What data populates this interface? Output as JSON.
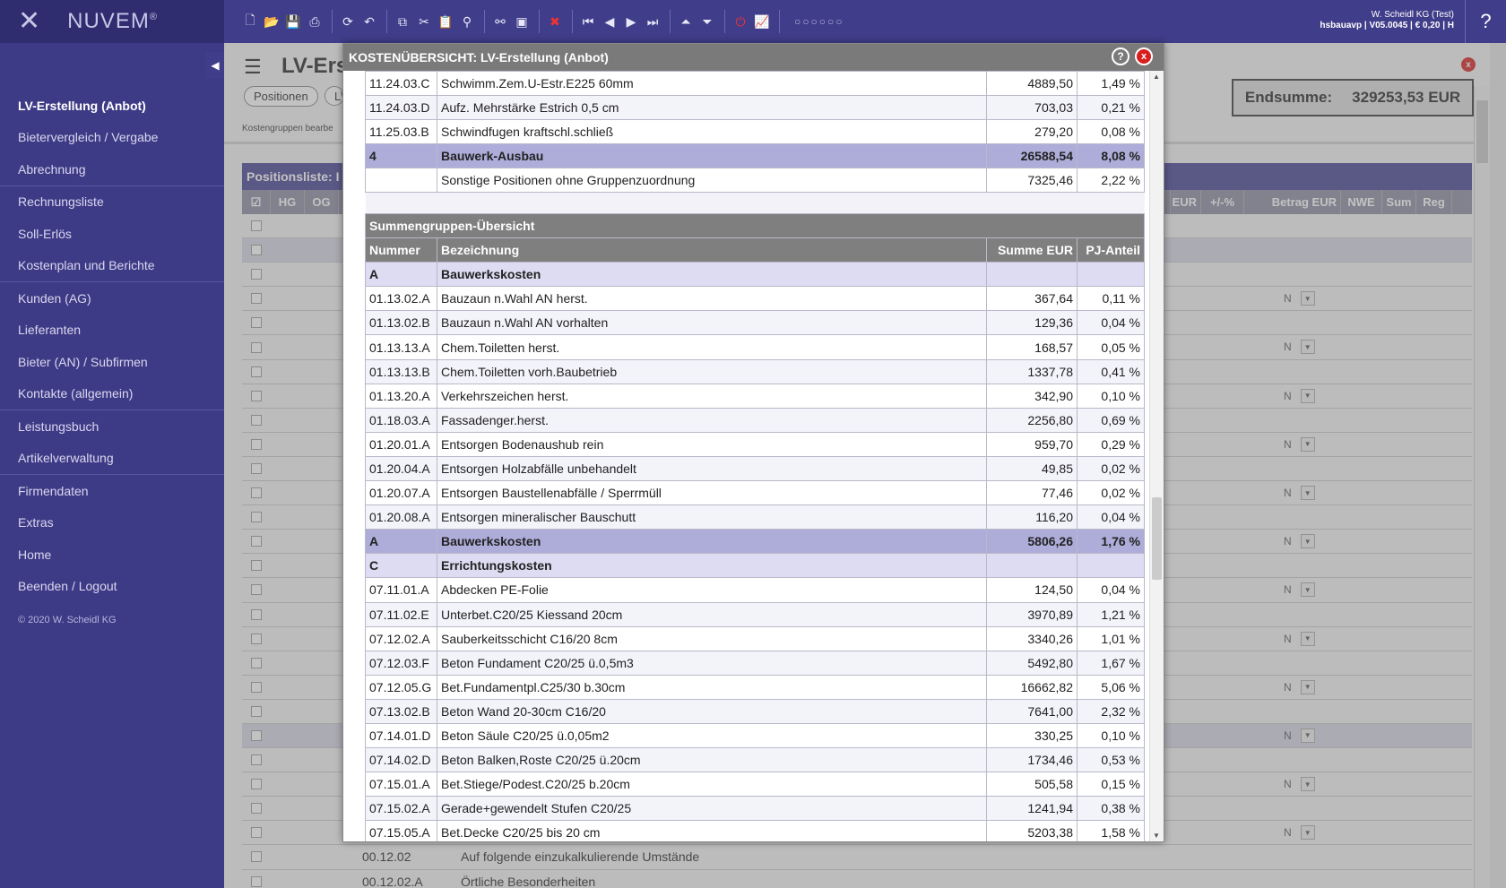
{
  "brand": {
    "name": "NUVEM",
    "mark": "®"
  },
  "sidebar": {
    "items": [
      {
        "label": "LV-Erstellung (Anbot)"
      },
      {
        "label": "Bietervergleich / Vergabe"
      },
      {
        "label": "Abrechnung"
      },
      {
        "label": "Rechnungsliste"
      },
      {
        "label": "Soll-Erlös"
      },
      {
        "label": "Kostenplan und Berichte"
      },
      {
        "label": "Kunden (AG)"
      },
      {
        "label": "Lieferanten"
      },
      {
        "label": "Bieter (AN) / Subfirmen"
      },
      {
        "label": "Kontakte (allgemein)"
      },
      {
        "label": "Leistungsbuch"
      },
      {
        "label": "Artikelverwaltung"
      },
      {
        "label": "Firmendaten"
      },
      {
        "label": "Extras"
      },
      {
        "label": "Home"
      },
      {
        "label": "Beenden / Logout"
      }
    ],
    "copyright": "© 2020 W. Scheidl KG"
  },
  "toolbar": {
    "dots": "○○○○○○",
    "help": "?",
    "user_line1": "W. Scheidl KG (Test)",
    "user_line2": "hsbauavp | V05.0045 | € 0,20 | H"
  },
  "background": {
    "title": "LV-Ers",
    "tab1": "Positionen",
    "tab2": "L\\",
    "subtitle": "Kostengruppen bearbe",
    "poslist": "Positionsliste: I",
    "endsum_label": "Endsumme:",
    "endsum_value": "329253,53 EUR",
    "columns": {
      "hg": "HG",
      "og": "OG",
      "eur": "EUR",
      "pm": "+/-%",
      "betrag": "Betrag EUR",
      "nwe": "NWE",
      "sum": "Sum",
      "reg": "Reg"
    },
    "nwe_value": "N",
    "bottom_rows": [
      {
        "nr": "00.12.02",
        "text": "Auf folgende einzukalkulierende Umstände"
      },
      {
        "nr": "00.12.02.A",
        "text": "Örtliche Besonderheiten"
      }
    ]
  },
  "modal": {
    "title": "KOSTENÜBERSICHT: LV-Erstellung (Anbot)",
    "help": "?",
    "close": "x",
    "top_rows": [
      {
        "kind": "odd",
        "nr": "11.24.03.C",
        "desc": "Schwimm.Zem.U-Estr.E225 60mm",
        "sum": "4889,50",
        "pct": "1,49 %"
      },
      {
        "kind": "even",
        "nr": "11.24.03.D",
        "desc": "Aufz. Mehrstärke Estrich 0,5 cm",
        "sum": "703,03",
        "pct": "0,21 %"
      },
      {
        "kind": "odd",
        "nr": "11.25.03.B",
        "desc": "Schwindfugen kraftschl.schließ",
        "sum": "279,20",
        "pct": "0,08 %"
      },
      {
        "kind": "group",
        "nr": "4",
        "desc": "Bauwerk-Ausbau",
        "sum": "26588,54",
        "pct": "8,08 %"
      },
      {
        "kind": "odd",
        "nr": "",
        "desc": "Sonstige Positionen ohne Gruppenzuordnung",
        "sum": "7325,46",
        "pct": "2,22 %"
      }
    ],
    "section_title": "Summengruppen-Übersicht",
    "columns": {
      "nr": "Nummer",
      "desc": "Bezeichnung",
      "sum": "Summe EUR",
      "pct": "PJ-Anteil"
    },
    "rows": [
      {
        "kind": "head",
        "nr": "A",
        "desc": "Bauwerkskosten",
        "sum": "",
        "pct": ""
      },
      {
        "kind": "odd",
        "nr": "01.13.02.A",
        "desc": "Bauzaun n.Wahl AN herst.",
        "sum": "367,64",
        "pct": "0,11 %"
      },
      {
        "kind": "even",
        "nr": "01.13.02.B",
        "desc": "Bauzaun n.Wahl AN vorhalten",
        "sum": "129,36",
        "pct": "0,04 %"
      },
      {
        "kind": "odd",
        "nr": "01.13.13.A",
        "desc": "Chem.Toiletten herst.",
        "sum": "168,57",
        "pct": "0,05 %"
      },
      {
        "kind": "even",
        "nr": "01.13.13.B",
        "desc": "Chem.Toiletten vorh.Baubetrieb",
        "sum": "1337,78",
        "pct": "0,41 %"
      },
      {
        "kind": "odd",
        "nr": "01.13.20.A",
        "desc": "Verkehrszeichen herst.",
        "sum": "342,90",
        "pct": "0,10 %"
      },
      {
        "kind": "even",
        "nr": "01.18.03.A",
        "desc": "Fassadenger.herst.",
        "sum": "2256,80",
        "pct": "0,69 %"
      },
      {
        "kind": "odd",
        "nr": "01.20.01.A",
        "desc": "Entsorgen Bodenaushub rein",
        "sum": "959,70",
        "pct": "0,29 %"
      },
      {
        "kind": "even",
        "nr": "01.20.04.A",
        "desc": "Entsorgen Holzabfälle unbehandelt",
        "sum": "49,85",
        "pct": "0,02 %"
      },
      {
        "kind": "odd",
        "nr": "01.20.07.A",
        "desc": "Entsorgen Baustellenabfälle / Sperrmüll",
        "sum": "77,46",
        "pct": "0,02 %"
      },
      {
        "kind": "even",
        "nr": "01.20.08.A",
        "desc": "Entsorgen mineralischer Bauschutt",
        "sum": "116,20",
        "pct": "0,04 %"
      },
      {
        "kind": "group",
        "nr": "A",
        "desc": "Bauwerkskosten",
        "sum": "5806,26",
        "pct": "1,76 %"
      },
      {
        "kind": "head",
        "nr": "C",
        "desc": "Errichtungskosten",
        "sum": "",
        "pct": ""
      },
      {
        "kind": "odd",
        "nr": "07.11.01.A",
        "desc": "Abdecken PE-Folie",
        "sum": "124,50",
        "pct": "0,04 %"
      },
      {
        "kind": "even",
        "nr": "07.11.02.E",
        "desc": "Unterbet.C20/25 Kiessand 20cm",
        "sum": "3970,89",
        "pct": "1,21 %"
      },
      {
        "kind": "odd",
        "nr": "07.12.02.A",
        "desc": "Sauberkeitsschicht C16/20 8cm",
        "sum": "3340,26",
        "pct": "1,01 %"
      },
      {
        "kind": "even",
        "nr": "07.12.03.F",
        "desc": "Beton Fundament C20/25 ü.0,5m3",
        "sum": "5492,80",
        "pct": "1,67 %"
      },
      {
        "kind": "odd",
        "nr": "07.12.05.G",
        "desc": "Bet.Fundamentpl.C25/30 b.30cm",
        "sum": "16662,82",
        "pct": "5,06 %"
      },
      {
        "kind": "even",
        "nr": "07.13.02.B",
        "desc": "Beton Wand 20-30cm C16/20",
        "sum": "7641,00",
        "pct": "2,32 %"
      },
      {
        "kind": "odd",
        "nr": "07.14.01.D",
        "desc": "Beton Säule C20/25 ü.0,05m2",
        "sum": "330,25",
        "pct": "0,10 %"
      },
      {
        "kind": "even",
        "nr": "07.14.02.D",
        "desc": "Beton Balken,Roste C20/25 ü.20cm",
        "sum": "1734,46",
        "pct": "0,53 %"
      },
      {
        "kind": "odd",
        "nr": "07.15.01.A",
        "desc": "Bet.Stiege/Podest.C20/25 b.20cm",
        "sum": "505,58",
        "pct": "0,15 %"
      },
      {
        "kind": "even",
        "nr": "07.15.02.A",
        "desc": "Gerade+gewendelt Stufen C20/25",
        "sum": "1241,94",
        "pct": "0,38 %"
      },
      {
        "kind": "odd",
        "nr": "07.15.05.A",
        "desc": "Bet.Decke C20/25 bis 20 cm",
        "sum": "5203,38",
        "pct": "1,58 %"
      }
    ]
  }
}
